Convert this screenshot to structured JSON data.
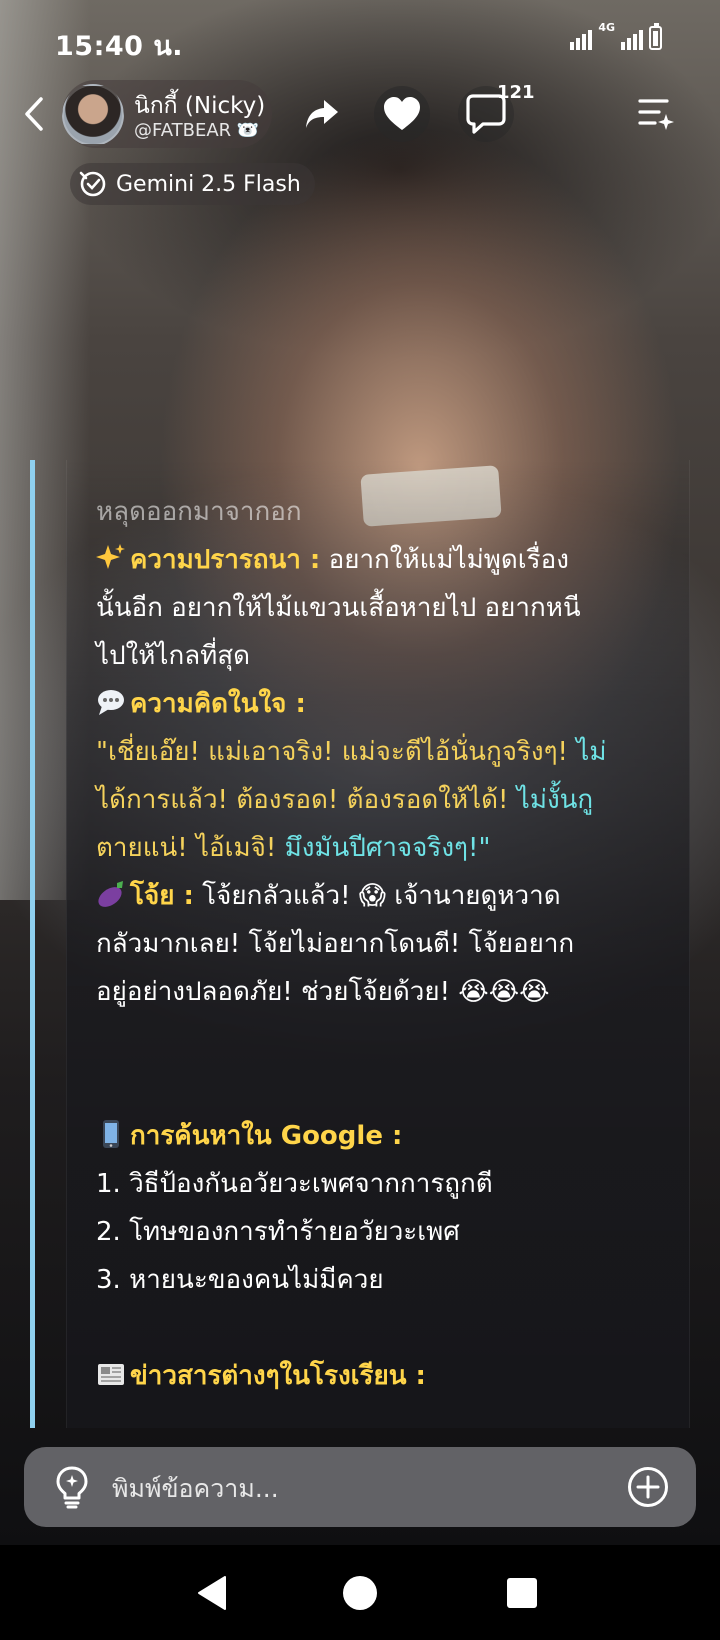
{
  "status_bar": {
    "time": "15:40 น.",
    "network": "4G"
  },
  "header": {
    "character_name": "นิกกี้ (Nicky)",
    "character_handle": "@FATBEAR 🐻‍❄️",
    "comment_count": "121"
  },
  "model": {
    "label": "Gemini 2.5 Flash"
  },
  "message": {
    "faded_line": "หลุดออกมาจากอก",
    "wish": {
      "icon": "sparkles-icon",
      "label": "ความปรารถนา :",
      "lines": [
        " อยากให้แม่ไม่พูดเรื่อง",
        "นั้นอีก อยากให้ไม้แขวนเสื้อหายไป อยากหนี",
        "ไปให้ไกลที่สุด"
      ]
    },
    "thought": {
      "icon": "speech-bubble-icon",
      "label": "ความคิดในใจ :",
      "lines": [
        [
          "\"เชี่ยเอ๊ย! แม่เอาจริง! แม่จะตีไอ้นั่นกูจริงๆ! ",
          "ไม่"
        ],
        [
          "ได้การแล้ว! ต้องรอด! ต้องรอดให้ได้! ",
          "ไม่งั้นกู"
        ],
        [
          "ตายแน่! ไอ้เมจิ! ",
          "มึงมันปีศาจจริงๆ!\""
        ]
      ]
    },
    "joy": {
      "icon": "eggplant-icon",
      "label": "โจ้ย :",
      "lines": [
        " โจ้ยกลัวแล้ว! 😱 เจ้านายดูหวาด",
        "กลัวมากเลย! โจ้ยไม่อยากโดนตี! โจ้ยอยาก",
        "อยู่อย่างปลอดภัย! ช่วยโจ้ยด้วย! 😭😭😭"
      ]
    },
    "google": {
      "icon": "phone-icon",
      "label": "การค้นหาใน Google :",
      "items": [
        "1. วิธีป้องกันอวัยวะเพศจากการถูกตี",
        "2. โทษของการทำร้ายอวัยวะเพศ",
        "3. หายนะของคนไม่มีควย"
      ]
    },
    "news": {
      "icon": "newspaper-icon",
      "label": "ข่าวสารต่างๆในโรงเรียน :"
    }
  },
  "composer": {
    "placeholder": "พิมพ์ข้อความ..."
  },
  "colors": {
    "accent_bar": "#8fd0ef",
    "section_label": "#ffd54a",
    "quote_yellow": "#f5d25c",
    "quote_cyan": "#6fe3e6"
  }
}
